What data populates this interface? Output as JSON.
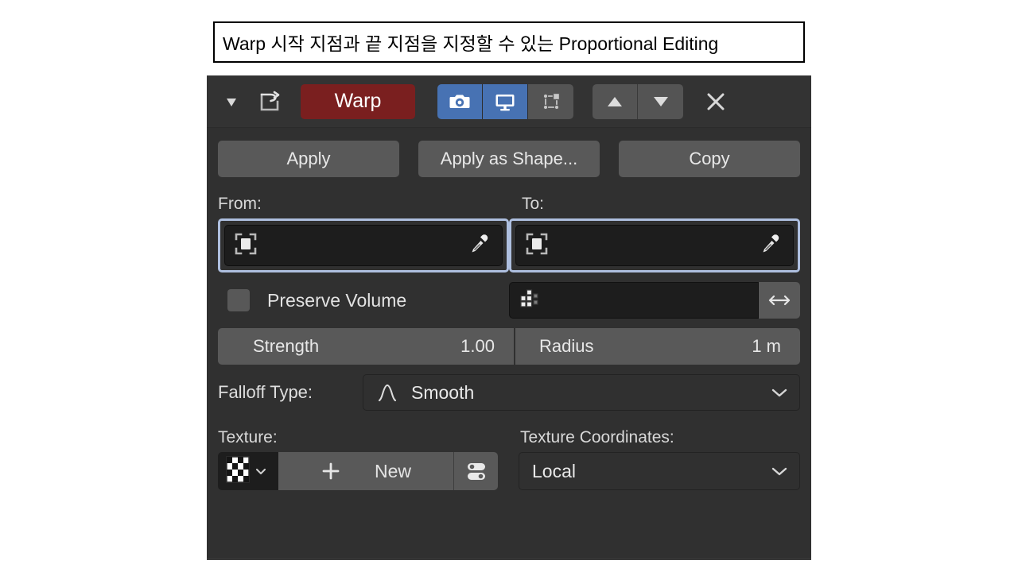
{
  "caption": {
    "text": "Warp 시작 지점과 끝 지점을 지정할 수 있는 Proportional Editing"
  },
  "colors": {
    "panel_bg": "#303030",
    "header_bg": "#333333",
    "name_field_red": "#7a1f1f",
    "toggle_active_blue": "#4772b3",
    "highlight_border": "#aebfdf",
    "button_gray": "#595959",
    "field_dark": "#1d1d1d"
  },
  "modifier_header": {
    "expand_icon": "triangle-down-icon",
    "type_icon": "warp-modifier-icon",
    "name": "Warp",
    "toggles": [
      {
        "icon": "camera-render-icon",
        "name": "render-toggle",
        "active": true
      },
      {
        "icon": "monitor-viewport-icon",
        "name": "viewport-toggle",
        "active": true
      },
      {
        "icon": "edit-mode-icon",
        "name": "edit-mode-toggle",
        "active": false
      }
    ],
    "move_up_icon": "triangle-up-icon",
    "move_down_icon": "triangle-down-icon",
    "close_icon": "close-x-icon"
  },
  "action_buttons": [
    {
      "label": "Apply",
      "name": "apply-button"
    },
    {
      "label": "Apply as Shape...",
      "name": "apply-as-shape-button"
    },
    {
      "label": "Copy",
      "name": "copy-button"
    }
  ],
  "object_fields": {
    "from_label": "From:",
    "to_label": "To:",
    "from_value": "",
    "to_value": "",
    "object_icon": "object-data-icon",
    "eyedropper_icon": "eyedropper-icon",
    "highlighted": true
  },
  "preserve_volume": {
    "label": "Preserve Volume",
    "checked": false
  },
  "vertex_group": {
    "icon": "vertex-group-icon",
    "value": "",
    "invert_icon": "invert-arrows-icon"
  },
  "sliders": [
    {
      "label": "Strength",
      "value": "1.00",
      "name": "strength-slider"
    },
    {
      "label": "Radius",
      "value": "1 m",
      "name": "radius-slider"
    }
  ],
  "falloff": {
    "label": "Falloff Type:",
    "value": "Smooth",
    "icon": "smooth-falloff-curve-icon",
    "chevron": "chevron-down-icon"
  },
  "texture": {
    "label": "Texture:",
    "browse_icon": "texture-checker-icon",
    "browse_chevron": "chevron-down-icon",
    "add_icon": "plus-icon",
    "new_label": "New",
    "properties_icon": "texture-properties-icon"
  },
  "texture_coordinates": {
    "label": "Texture Coordinates:",
    "value": "Local",
    "chevron": "chevron-down-icon"
  }
}
